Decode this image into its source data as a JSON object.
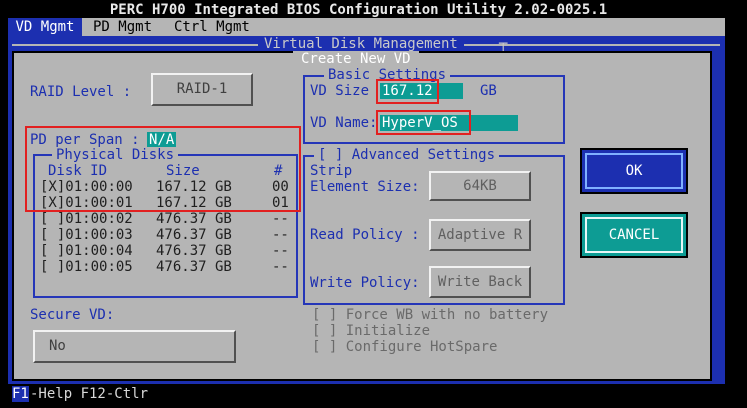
{
  "app": {
    "title": "PERC H700 Integrated BIOS Configuration Utility 2.02-0025.1"
  },
  "menu": {
    "items": [
      "VD Mgmt",
      "PD Mgmt",
      "Ctrl Mgmt"
    ]
  },
  "panel": {
    "title": "Virtual Disk Management",
    "mark": "┬"
  },
  "dialog": {
    "title": "Create New VD",
    "raid_level_label": "RAID Level :",
    "raid_level_value": "RAID-1",
    "pd_per_span_label": "PD per Span :",
    "pd_per_span_value": "N/A",
    "physical_disks": {
      "title": "Physical Disks",
      "headers": [
        "Disk ID",
        "Size",
        "#"
      ],
      "rows": [
        {
          "check": "[X]",
          "id": "01:00:00",
          "size": "167.12 GB",
          "num": "00"
        },
        {
          "check": "[X]",
          "id": "01:00:01",
          "size": "167.12 GB",
          "num": "01"
        },
        {
          "check": "[ ]",
          "id": "01:00:02",
          "size": "476.37 GB",
          "num": "--"
        },
        {
          "check": "[ ]",
          "id": "01:00:03",
          "size": "476.37 GB",
          "num": "--"
        },
        {
          "check": "[ ]",
          "id": "01:00:04",
          "size": "476.37 GB",
          "num": "--"
        },
        {
          "check": "[ ]",
          "id": "01:00:05",
          "size": "476.37 GB",
          "num": "--"
        }
      ]
    },
    "secure_vd_label": "Secure VD:",
    "secure_vd_value": "No",
    "basic_settings": {
      "title": "Basic Settings",
      "vd_size_label": "VD Size",
      "vd_size_value": "167.12",
      "vd_size_unit": "GB",
      "vd_name_label": "VD Name:",
      "vd_name_value": "HyperV_OS"
    },
    "advanced_settings": {
      "title": "[ ] Advanced Settings",
      "strip_label_1": "Strip",
      "strip_label_2": "Element Size:",
      "strip_value": "64KB",
      "read_policy_label": "Read Policy :",
      "read_policy_value": "Adaptive R",
      "write_policy_label": "Write Policy:",
      "write_policy_value": "Write Back",
      "force_wb": "[ ] Force WB with no battery",
      "initialize": "[ ] Initialize",
      "configure_hotspare": "[ ] Configure HotSpare"
    },
    "ok_label": "OK",
    "cancel_label": "CANCEL"
  },
  "status": {
    "key": "F1",
    "text": "-Help F12-Ctlr"
  },
  "colors": {
    "blue": "#1c2fb0",
    "gray": "#b5b5b5",
    "teal": "#0d9c94",
    "highlight_red": "#e22020"
  }
}
